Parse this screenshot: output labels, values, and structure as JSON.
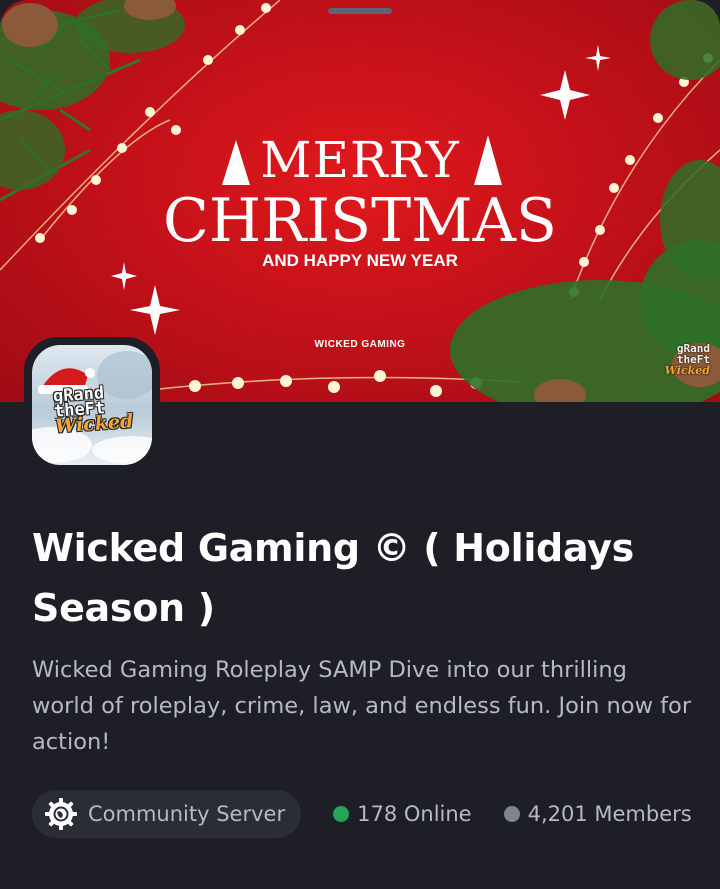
{
  "banner": {
    "headline_line1": "MERRY",
    "headline_line2": "CHRISTMAS",
    "subline": "AND HAPPY NEW YEAR",
    "brand": "WICKED GAMING",
    "corner_logo": {
      "line1": "gRand",
      "line2": "theFt",
      "line3": "Wicked"
    },
    "background_color": "#c4111a"
  },
  "server_icon": {
    "line1": "gRand",
    "line2": "theFt",
    "line3": "Wicked"
  },
  "server": {
    "name": "Wicked Gaming © ( Holidays Season )",
    "description": "Wicked Gaming Roleplay SAMP Dive into our thrilling world of roleplay, crime, law, and endless fun. Join now for action!"
  },
  "stats": {
    "community_label": "Community Server",
    "community_icon": "gear-globe-icon",
    "online_label": "178 Online",
    "online_color": "#23a55a",
    "members_label": "4,201 Members",
    "members_color": "#80848e"
  },
  "colors": {
    "background": "#1e1f26",
    "chip": "#2b2d35",
    "text_primary": "#ffffff",
    "text_secondary": "#b5bac1"
  }
}
